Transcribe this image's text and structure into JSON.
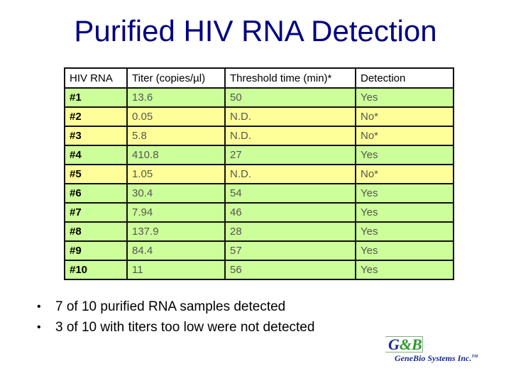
{
  "title": "Purified HIV RNA Detection",
  "table": {
    "headers": [
      "HIV RNA",
      "Titer (copies/µl)",
      "Threshold time (min)*",
      "Detection"
    ],
    "rows": [
      {
        "id": "#1",
        "titer": "13.6",
        "threshold": "50",
        "detection": "Yes"
      },
      {
        "id": "#2",
        "titer": "0.05",
        "threshold": "N.D.",
        "detection": "No*"
      },
      {
        "id": "#3",
        "titer": "5.8",
        "threshold": "N.D.",
        "detection": "No*"
      },
      {
        "id": "#4",
        "titer": "410.8",
        "threshold": "27",
        "detection": "Yes"
      },
      {
        "id": "#5",
        "titer": "1.05",
        "threshold": "N.D.",
        "detection": "No*"
      },
      {
        "id": "#6",
        "titer": "30.4",
        "threshold": "54",
        "detection": "Yes"
      },
      {
        "id": "#7",
        "titer": "7.94",
        "threshold": "46",
        "detection": "Yes"
      },
      {
        "id": "#8",
        "titer": "137.9",
        "threshold": "28",
        "detection": "Yes"
      },
      {
        "id": "#9",
        "titer": "84.4",
        "threshold": "57",
        "detection": "Yes"
      },
      {
        "id": "#10",
        "titer": "11",
        "threshold": "56",
        "detection": "Yes"
      }
    ],
    "colors": {
      "detected_row": "#ccff99",
      "not_detected_row": "#ffff99"
    }
  },
  "bullets": [
    "7 of 10 purified RNA samples detected",
    "3 of 10 with titers too low were not detected"
  ],
  "logo": {
    "badge_left": "G",
    "badge_mid": "&",
    "badge_right": "B",
    "company": "GeneBio Systems Inc.",
    "trademark": "TM"
  }
}
